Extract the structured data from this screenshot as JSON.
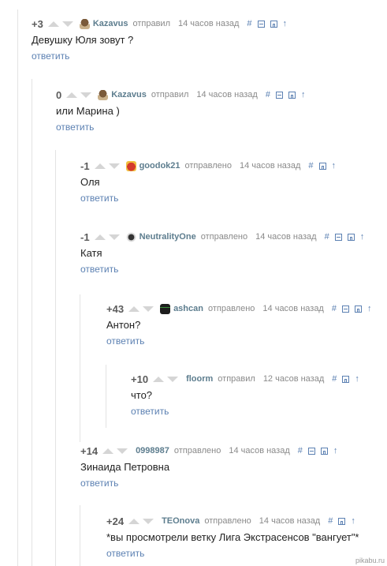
{
  "reply_label": "ответить",
  "comments": [
    {
      "rating": "+3",
      "author": "Kazavus",
      "verb": "отправил",
      "time": "14 часов назад",
      "text": "Девушку Юля зовут ?"
    },
    {
      "rating": "0",
      "author": "Kazavus",
      "verb": "отправил",
      "time": "14 часов назад",
      "text": "или Марина )"
    },
    {
      "rating": "-1",
      "author": "goodok21",
      "verb": "отправлено",
      "time": "14 часов назад",
      "text": "Оля"
    },
    {
      "rating": "-1",
      "author": "NeutralityOne",
      "verb": "отправлено",
      "time": "14 часов назад",
      "text": "Катя"
    },
    {
      "rating": "+43",
      "author": "ashcan",
      "verb": "отправлено",
      "time": "14 часов назад",
      "text": "Антон?"
    },
    {
      "rating": "+10",
      "author": "floorm",
      "verb": "отправил",
      "time": "12 часов назад",
      "text": "что?"
    },
    {
      "rating": "+14",
      "author": "0998987",
      "verb": "отправлено",
      "time": "14 часов назад",
      "text": "Зинаида Петровна"
    },
    {
      "rating": "+24",
      "author": "TEOnova",
      "verb": "отправлено",
      "time": "14 часов назад",
      "text": "*вы просмотрели ветку Лига Экстрасенсов \"вангует\"*"
    }
  ],
  "tools": {
    "hash": "#"
  },
  "watermark": "pikabu.ru",
  "colors": {
    "link": "#5b80b2",
    "author": "#5d7d8e",
    "meta": "#8a8a8a",
    "thread_line": "#e3e3e3"
  },
  "avatars": [
    "mushroom",
    "mushroom",
    "red-face",
    "none",
    "cat",
    "black-can",
    "none",
    "none",
    "none"
  ]
}
